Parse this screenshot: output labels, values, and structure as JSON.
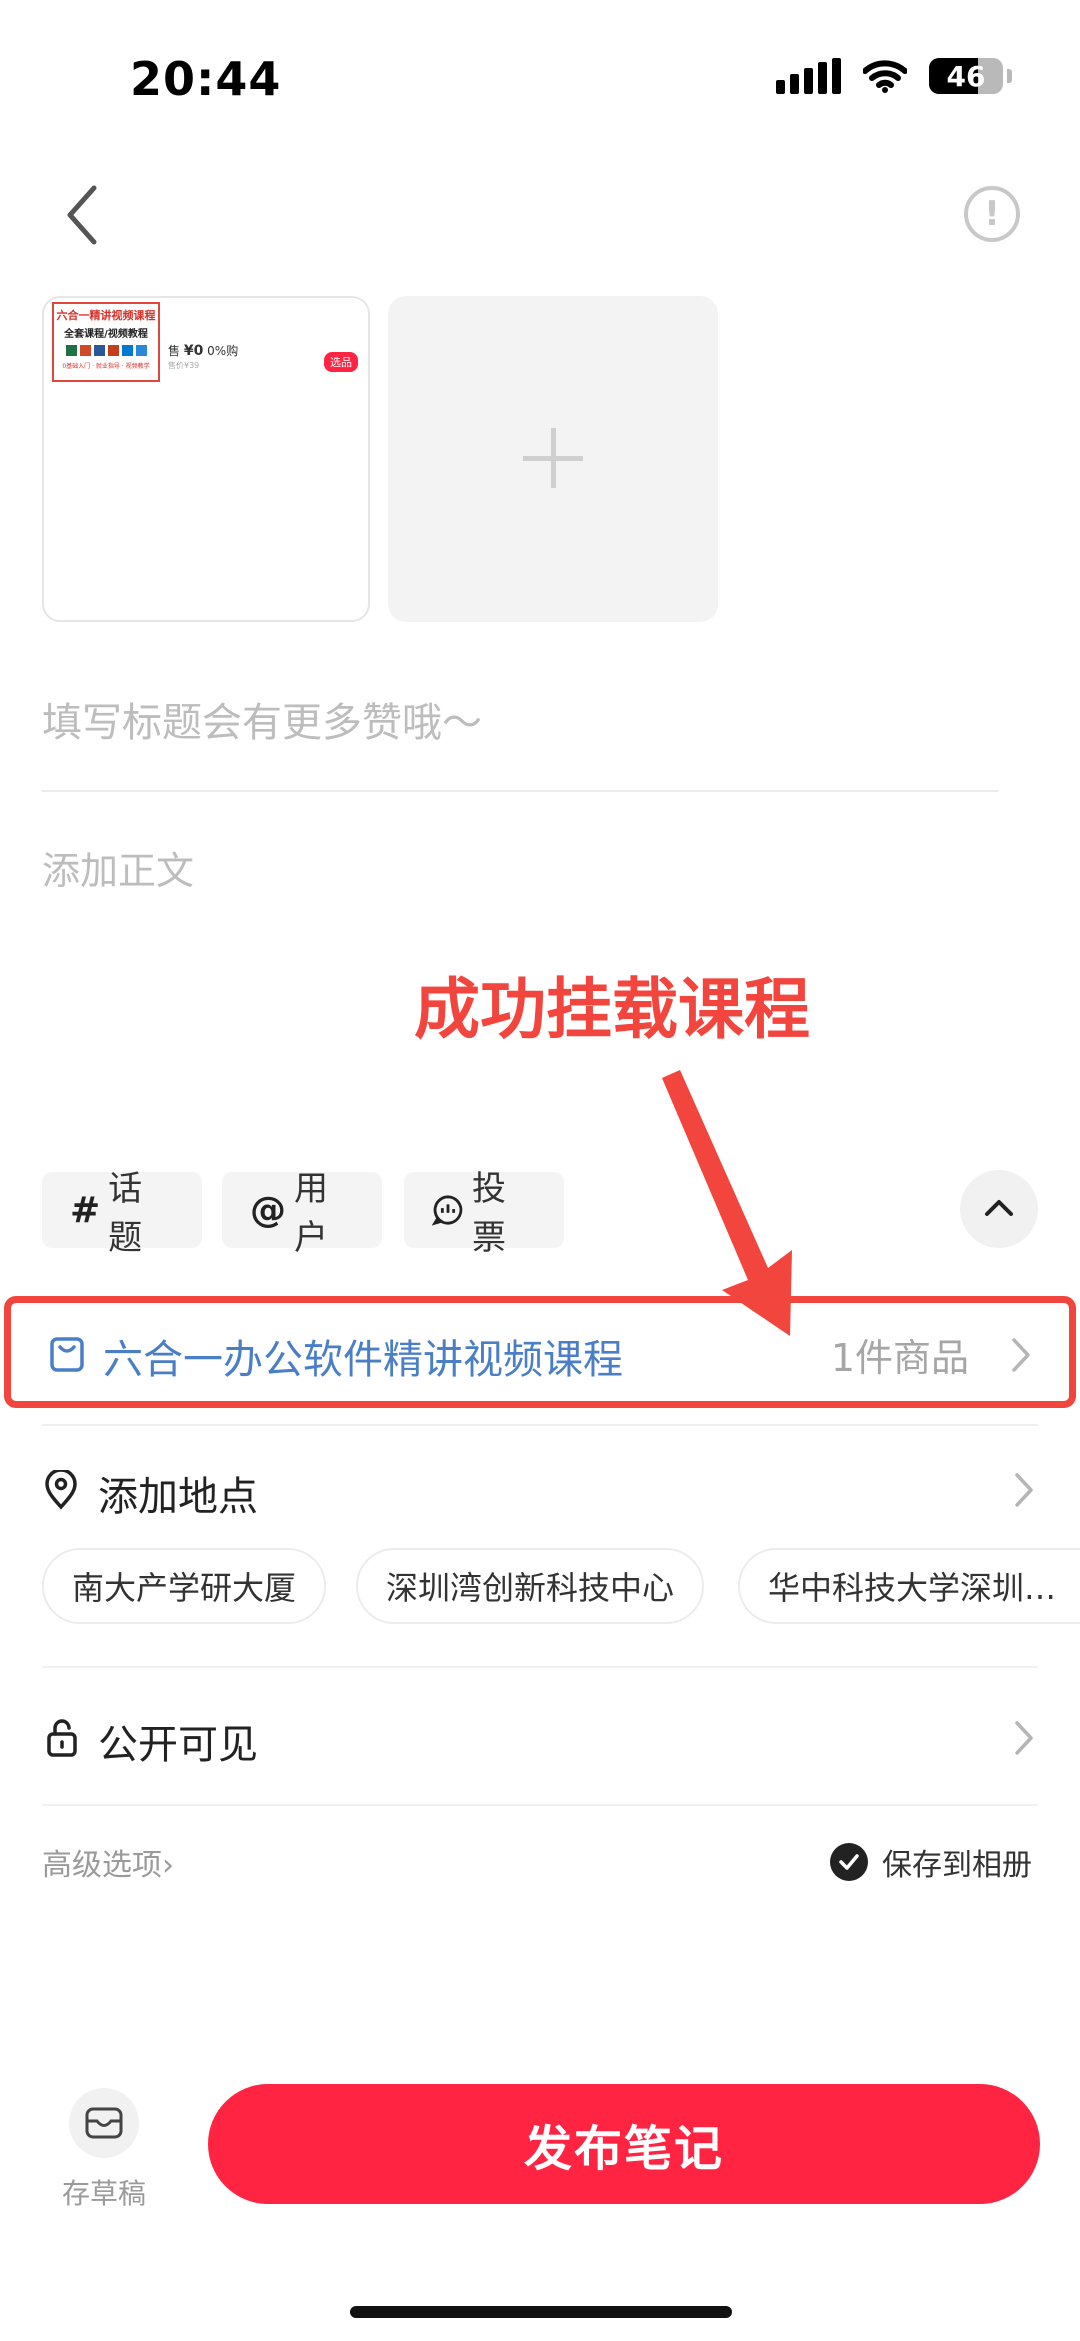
{
  "status_bar": {
    "time": "20:44",
    "battery": "46"
  },
  "media": {
    "thumb": {
      "cover_title": "六合一精讲视频课程",
      "cover_subtitle": "全套课程/视频教程",
      "cover_footer": "0基础入门 · 就业指导 · 视频教学",
      "price": "¥0",
      "price_prefix": "售",
      "discount": "0%购",
      "sold": "售价¥39",
      "tag": "选品"
    }
  },
  "editor": {
    "title_placeholder": "填写标题会有更多赞哦～",
    "body_placeholder": "添加正文"
  },
  "annotation": {
    "text": "成功挂载课程"
  },
  "toolbar": {
    "topic": {
      "icon": "#",
      "label": "话题"
    },
    "user": {
      "icon": "@",
      "label": "用户"
    },
    "vote": {
      "label": "投票"
    }
  },
  "product": {
    "name": "六合一办公软件精讲视频课程",
    "count": "1件商品"
  },
  "location": {
    "label": "添加地点",
    "suggestions": [
      "南大产学研大厦",
      "深圳湾创新科技中心",
      "华中科技大学深圳…"
    ]
  },
  "visibility": {
    "label": "公开可见"
  },
  "options": {
    "advanced": "高级选项",
    "save_album": "保存到相册"
  },
  "bottom": {
    "draft": "存草稿",
    "publish": "发布笔记"
  },
  "colors": {
    "accent": "#ff2442",
    "link": "#4a7fc7",
    "annotation": "#f2453d"
  }
}
